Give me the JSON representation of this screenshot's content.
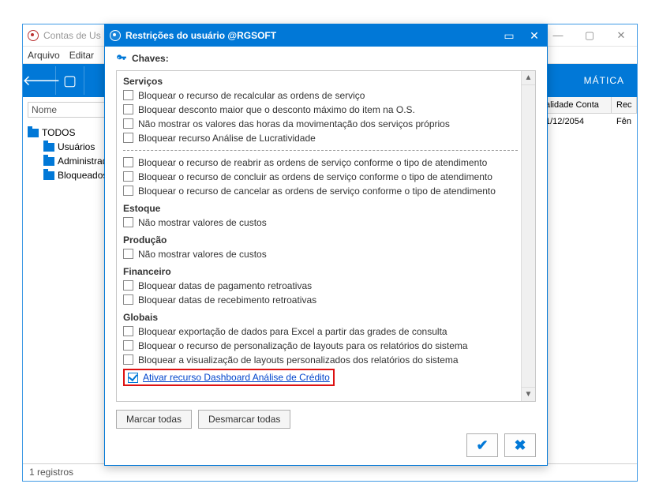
{
  "bgWindow": {
    "title": "Contas de Us",
    "menu": {
      "arquivo": "Arquivo",
      "editar": "Editar"
    },
    "brand": "MÁTICA",
    "nomeLabel": "Nome",
    "tree": {
      "root": "TODOS",
      "items": [
        "Usuários",
        "Administrado",
        "Bloqueados"
      ]
    },
    "columns": {
      "validade": "alidade Conta",
      "rec": "Rec"
    },
    "row": {
      "date": "1/12/2054",
      "rec": "Fên"
    },
    "status": "1 registros"
  },
  "modal": {
    "title": "Restrições do usuário @RGSOFT",
    "keysLabel": "Chaves:",
    "sections": {
      "servicos": {
        "heading": "Serviços",
        "items": [
          "Bloquear o recurso de recalcular as ordens de serviço",
          "Bloquear desconto maior que o desconto máximo do item na O.S.",
          "Não mostrar os valores das horas da movimentação dos serviços próprios",
          "Bloquear recurso Análise de Lucratividade"
        ],
        "items2": [
          "Bloquear o recurso de reabrir as ordens de serviço conforme o tipo de atendimento",
          "Bloquear o recurso de concluir as ordens de serviço conforme o tipo de atendimento",
          "Bloquear o recurso de cancelar as ordens de serviço conforme o tipo de atendimento"
        ]
      },
      "estoque": {
        "heading": "Estoque",
        "items": [
          "Não mostrar valores de custos"
        ]
      },
      "producao": {
        "heading": "Produção",
        "items": [
          "Não mostrar valores de custos"
        ]
      },
      "financeiro": {
        "heading": "Financeiro",
        "items": [
          "Bloquear datas de pagamento retroativas",
          "Bloquear datas de recebimento retroativas"
        ]
      },
      "globais": {
        "heading": "Globais",
        "items": [
          "Bloquear exportação de dados para Excel a partir das grades de consulta",
          "Bloquear o recurso de personalização de layouts para os relatórios do sistema",
          "Bloquear a visualização de layouts personalizados dos relatórios do sistema"
        ],
        "highlight": "Ativar recurso Dashboard Análise de Crédito"
      }
    },
    "buttons": {
      "checkAll": "Marcar todas",
      "uncheckAll": "Desmarcar todas"
    }
  }
}
